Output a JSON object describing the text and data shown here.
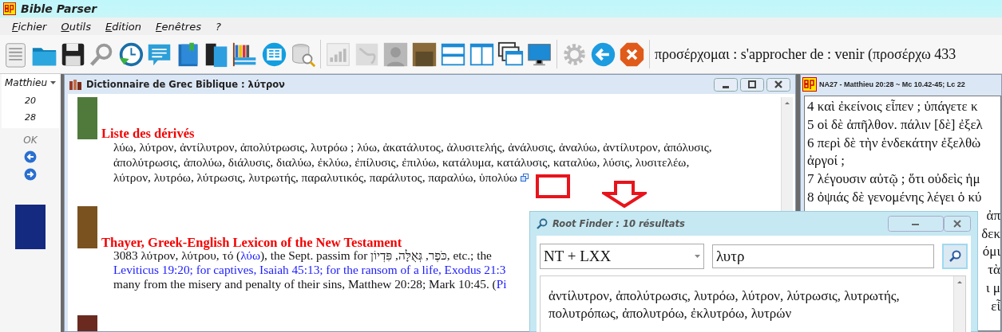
{
  "window": {
    "title": "Bible Parser"
  },
  "menu": [
    {
      "label": "Fichier"
    },
    {
      "label": "Outils"
    },
    {
      "label": "Edition"
    },
    {
      "label": "Fenêtres"
    },
    {
      "label": "?"
    }
  ],
  "toolbar": {
    "definition": "προσέρχομαι : s'approcher de : venir (προσέρχω 433"
  },
  "navigator": {
    "book": "Matthieu",
    "chapter": "20",
    "verse": "28",
    "ok": "OK"
  },
  "dictionary": {
    "title": "Dictionnaire de Grec Biblique : λύτρον",
    "entries": [
      {
        "heading": "Liste des dérivés",
        "lines": [
          [
            {
              "kind": "plain",
              "text": "λύω, λύτρον, ἀντίλυτρον, ἀπολύτρωσις, λυτρόω ; λύω, ἀκατάλυτος, ἀλυσιτελής, ἀνάλυσις, ἀναλύω, ἀντίλυτρον, ἀπόλυσις,"
            }
          ],
          [
            {
              "kind": "plain",
              "text": "ἀπολύτρωσις, ἀπολύω, διάλυσις, διαλύω, ἐκλύω, ἐπίλυσις, ἐπιλύω, κατάλυμα, κατάλυσις, καταλύω, λύσις, λυσιτελέω,"
            }
          ],
          [
            {
              "kind": "plain",
              "text": "λύτρον, λυτρόω, λύτρωσις, λυτρωτής, παραλυτικός, παράλυτος, παραλύω, ὑπολύω"
            }
          ]
        ],
        "root_link": true
      },
      {
        "heading": "Thayer, Greek-English Lexicon of the New Testament",
        "lines": [
          [
            {
              "kind": "plain",
              "text": "3083 λύτρον, λύτρου, τό ("
            },
            {
              "kind": "link",
              "text": "λύω"
            },
            {
              "kind": "plain",
              "text": "), the Sept. passim for כֹּפֶר, גְּאֻלָּה, פִּדְיוֹן, etc.; the"
            }
          ],
          [
            {
              "kind": "link",
              "text": "Leviticus 19:20; for captives, Isaiah 45:13; for the ransom of a life, Exodus 21:3"
            }
          ],
          [
            {
              "kind": "plain",
              "text": "many from the misery and penalty of their sins, Matthew 20:28; Mark 10:45. ("
            },
            {
              "kind": "link",
              "text": "Pi"
            }
          ]
        ],
        "root_link": false
      }
    ]
  },
  "text_window": {
    "title": "NA27 - Matthieu 20:28 ~ Mc 10.42-45; Lc 22",
    "lines": [
      {
        "text": "4 καὶ ἐκείνοις εἶπεν ;  ὑπάγετε κ",
        "covered": false
      },
      {
        "text": "5 οἱ δὲ ἀπῆλθον. πάλιν [δὲ] ἐξελ",
        "covered": false
      },
      {
        "text": "6 περὶ δὲ τὴν ἑνδεκάτην ἐξελθὼ",
        "covered": false
      },
      {
        "text": "ἀργοί ;",
        "covered": false
      },
      {
        "text": "7 λέγουσιν αὐτῷ ;  ὅτι οὐδεὶς ἡμ",
        "covered": false
      },
      {
        "text": "8 ὀψιάς δὲ γενομένης λέγει ὁ κύ",
        "covered": false
      },
      {
        "text": "ἀπ",
        "covered": true
      },
      {
        "text": "δεκ",
        "covered": true
      },
      {
        "text": "όμι",
        "covered": true
      },
      {
        "text": "τὰ",
        "covered": true
      },
      {
        "text": "ι μ",
        "covered": true
      },
      {
        "text": "εἶ",
        "covered": true
      }
    ]
  },
  "root_finder": {
    "title": "Root Finder : 10 résultats",
    "corpus": "NT + LXX",
    "query": "λυτρ",
    "results": "ἀντίλυτρον, ἀπολύτρωσις, λυτρόω, λύτρον, λύτρωσις, λυτρωτής, πολυτρόπως, ἀπολυτρόω, ἐκλυτρόω, λυτρών"
  }
}
